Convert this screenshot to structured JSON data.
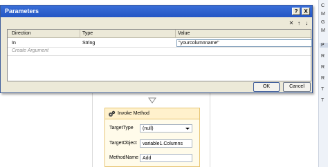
{
  "dialog": {
    "title": "Parameters",
    "help_label": "?",
    "close_label": "X",
    "toolbar": {
      "delete_symbol": "✕",
      "move_up_symbol": "↑",
      "move_down_symbol": "↓"
    },
    "grid": {
      "columns": [
        "Direction",
        "Type",
        "Value"
      ],
      "rows": [
        {
          "direction": "In",
          "type": "String",
          "value": "\"yourcolumnname\""
        }
      ],
      "create_argument_label": "Create Argument"
    },
    "ok_label": "OK",
    "cancel_label": "Cancel"
  },
  "activity": {
    "title": "Invoke Method",
    "icon": "gears-icon",
    "fields": {
      "target_type_label": "TargetType",
      "target_type_value": "(null)",
      "target_object_label": "TargetObject",
      "target_object_value": "variable1.Columns",
      "method_name_label": "MethodName",
      "method_name_value": "Add"
    }
  },
  "right_panel": {
    "items": [
      "C",
      "M",
      "G",
      "M",
      "P",
      "R",
      "R",
      "R",
      "T",
      "T"
    ]
  },
  "colors": {
    "titlebar": "#2456c4",
    "dialog_bg": "#ece9d8",
    "activity_border": "#e7c472",
    "activity_bg": "#fffbea"
  }
}
